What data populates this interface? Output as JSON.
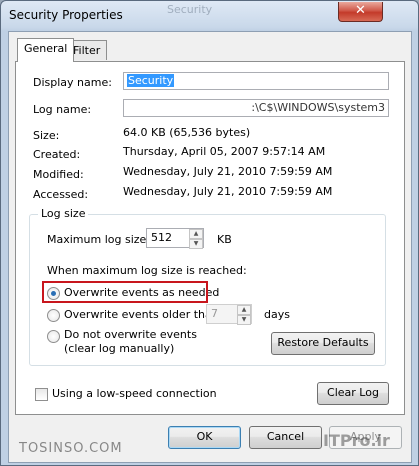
{
  "window": {
    "title": "Security Properties",
    "close_glyph": "✕",
    "ghost_title": "Security"
  },
  "tabs": [
    {
      "label": "General"
    },
    {
      "label": "Filter"
    }
  ],
  "general": {
    "display_name_label": "Display name:",
    "display_name_value": "Security",
    "log_name_label": "Log name:",
    "log_name_value": ":\\C$\\WINDOWS\\system3",
    "size_label": "Size:",
    "size_value": "64.0 KB (65,536 bytes)",
    "created_label": "Created:",
    "created_value": "Thursday, April 05, 2007 9:57:14 AM",
    "modified_label": "Modified:",
    "modified_value": "Wednesday, July 21, 2010 7:59:59 AM",
    "accessed_label": "Accessed:",
    "accessed_value": "Wednesday, July 21, 2010 7:59:59 AM"
  },
  "log_size": {
    "group_label": "Log size",
    "max_size_label": "Maximum log size:",
    "max_size_value": "512",
    "max_size_unit": "KB",
    "when_reached_label": "When maximum log size is reached:",
    "options": [
      {
        "label": "Overwrite events as needed",
        "checked": true
      },
      {
        "label": "Overwrite events older than",
        "checked": false
      },
      {
        "label": "Do not overwrite events",
        "sub": "(clear log manually)",
        "checked": false
      }
    ],
    "days_value": "7",
    "days_unit": "days",
    "restore_defaults": "Restore Defaults"
  },
  "bottom": {
    "low_speed_label": "Using a low-speed connection",
    "clear_log": "Clear Log"
  },
  "buttons": {
    "ok": "OK",
    "cancel": "Cancel",
    "apply": "Apply"
  },
  "watermarks": {
    "left": "TOSINSO.COM",
    "right": "ITPro.ir"
  },
  "colors": {
    "highlight_border": "#c8161d",
    "selection": "#3399ff",
    "radio_dot": "#2b6fb5"
  }
}
